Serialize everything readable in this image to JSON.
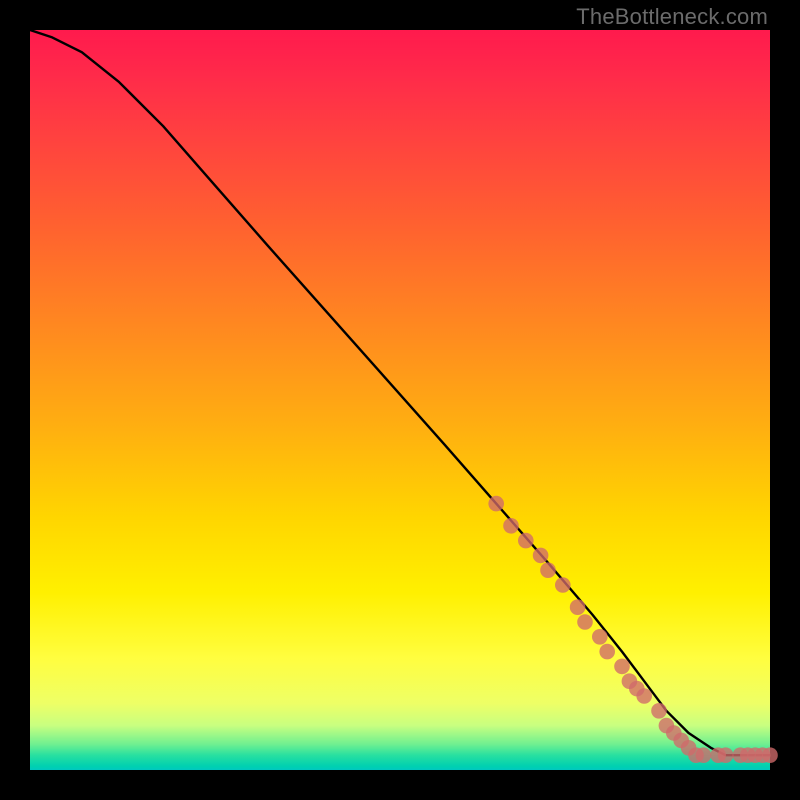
{
  "watermark": "TheBottleneck.com",
  "chart_data": {
    "type": "line",
    "title": "",
    "xlabel": "",
    "ylabel": "",
    "xlim": [
      0,
      100
    ],
    "ylim": [
      0,
      100
    ],
    "grid": false,
    "series": [
      {
        "name": "bottleneck-curve",
        "x": [
          0,
          3,
          7,
          12,
          18,
          25,
          32,
          40,
          48,
          56,
          63,
          70,
          76,
          80,
          83,
          86,
          89,
          92,
          94,
          96,
          98,
          100
        ],
        "y": [
          100,
          99,
          97,
          93,
          87,
          79,
          71,
          62,
          53,
          44,
          36,
          28,
          21,
          16,
          12,
          8,
          5,
          3,
          2,
          2,
          2,
          2
        ]
      }
    ],
    "markers": {
      "name": "highlighted-points",
      "color": "#cf6a6a",
      "points": [
        {
          "x": 63,
          "y": 36
        },
        {
          "x": 65,
          "y": 33
        },
        {
          "x": 67,
          "y": 31
        },
        {
          "x": 69,
          "y": 29
        },
        {
          "x": 70,
          "y": 27
        },
        {
          "x": 72,
          "y": 25
        },
        {
          "x": 74,
          "y": 22
        },
        {
          "x": 75,
          "y": 20
        },
        {
          "x": 77,
          "y": 18
        },
        {
          "x": 78,
          "y": 16
        },
        {
          "x": 80,
          "y": 14
        },
        {
          "x": 81,
          "y": 12
        },
        {
          "x": 82,
          "y": 11
        },
        {
          "x": 83,
          "y": 10
        },
        {
          "x": 85,
          "y": 8
        },
        {
          "x": 86,
          "y": 6
        },
        {
          "x": 87,
          "y": 5
        },
        {
          "x": 88,
          "y": 4
        },
        {
          "x": 89,
          "y": 3
        },
        {
          "x": 90,
          "y": 2
        },
        {
          "x": 91,
          "y": 2
        },
        {
          "x": 93,
          "y": 2
        },
        {
          "x": 94,
          "y": 2
        },
        {
          "x": 96,
          "y": 2
        },
        {
          "x": 97,
          "y": 2
        },
        {
          "x": 98,
          "y": 2
        },
        {
          "x": 99,
          "y": 2
        },
        {
          "x": 100,
          "y": 2
        }
      ]
    }
  }
}
